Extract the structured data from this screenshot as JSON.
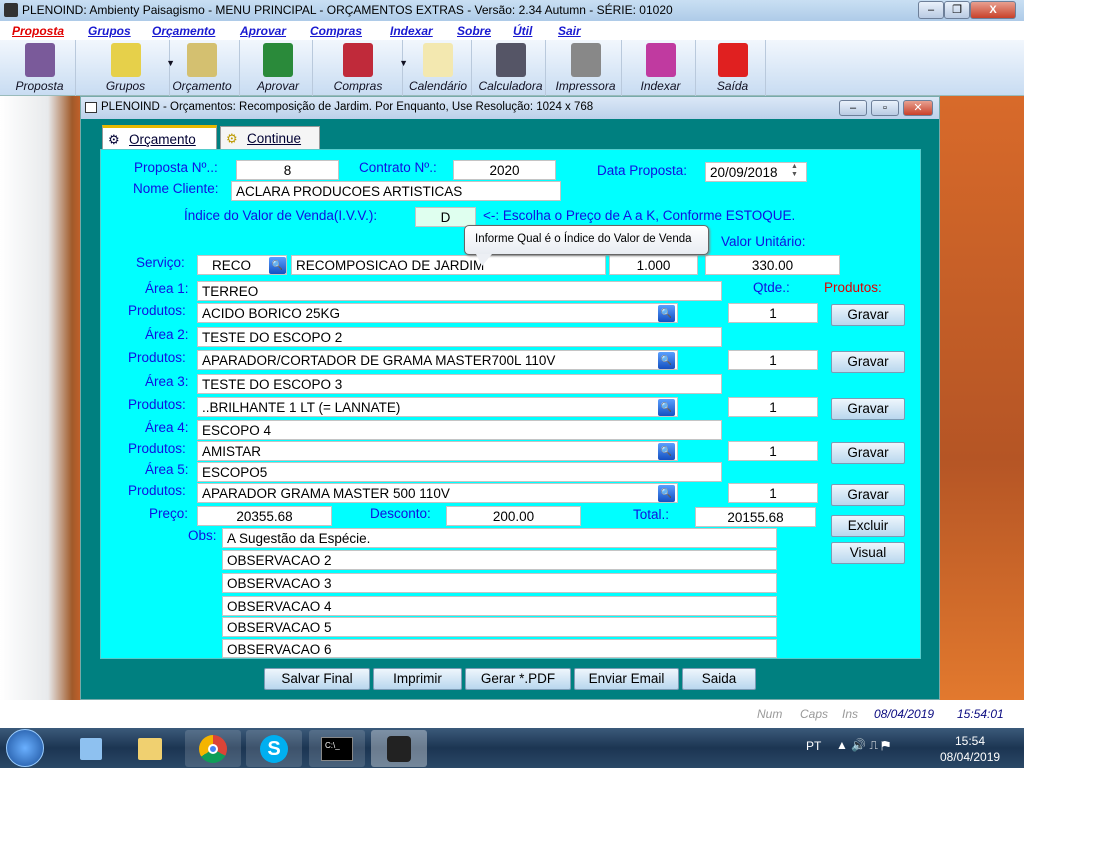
{
  "app": {
    "title": "PLENOIND: Ambienty Paisagismo - MENU PRINCIPAL - ORÇAMENTOS EXTRAS - Versão: 2.34 Autumn - SÉRIE: 01020"
  },
  "menu": [
    {
      "label": "Proposta",
      "color": "#e00000"
    },
    {
      "label": "Grupos"
    },
    {
      "label": "Orçamento"
    },
    {
      "label": "Aprovar"
    },
    {
      "label": "Compras"
    },
    {
      "label": "Indexar"
    },
    {
      "label": "Sobre"
    },
    {
      "label": "Útil"
    },
    {
      "label": "Sair"
    }
  ],
  "toolbar": [
    {
      "label": "Proposta",
      "icon": "proposal-icon"
    },
    {
      "label": "Grupos",
      "icon": "groups-icon"
    },
    {
      "label": "Orçamento",
      "icon": "budget-icon"
    },
    {
      "label": "Aprovar",
      "icon": "approve-icon"
    },
    {
      "label": "Compras",
      "icon": "purchases-icon"
    },
    {
      "label": "Calendário",
      "icon": "calendar-icon"
    },
    {
      "label": "Calculadora",
      "icon": "calculator-icon"
    },
    {
      "label": "Impressora",
      "icon": "printer-icon"
    },
    {
      "label": "Indexar",
      "icon": "index-icon"
    },
    {
      "label": "Saída",
      "icon": "exit-icon"
    }
  ],
  "window": {
    "title": "PLENOIND - Orçamentos: Recomposição de Jardim. Por Enquanto, Use Resolução: 1024 x 768"
  },
  "tabs": [
    {
      "label": "Orçamento",
      "active": true
    },
    {
      "label": "Continue"
    }
  ],
  "form": {
    "proposta_label": "Proposta Nº..:",
    "proposta": "8",
    "contrato_label": "Contrato Nº.:",
    "contrato": "2020",
    "data_label": "Data Proposta:",
    "data": "20/09/2018",
    "cliente_label": "Nome Cliente:",
    "cliente": "ACLARA PRODUCOES ARTISTICAS",
    "ivv_label": "Índice do Valor de Venda(I.V.V.):",
    "ivv": "D",
    "ivv_hint": "<-: Escolha o Preço de A a K, Conforme ESTOQUE.",
    "tooltip": "Informe Qual é o Índice do Valor de Venda",
    "qtde_header": "Qtde:",
    "valor_header": "Valor Unitário:",
    "servico_label": "Serviço:",
    "servico_code": "RECO",
    "servico_desc": "RECOMPOSICAO DE JARDIM",
    "servico_qtde": "1.000",
    "servico_valor": "330.00",
    "qtde2_header": "Qtde.:",
    "produtos_header": "Produtos:",
    "produtos_label": "Produtos:",
    "gravar_label": "Gravar",
    "areas": [
      {
        "label": "Área 1:",
        "value": "TERREO",
        "produto": "ACIDO BORICO 25KG",
        "qtde": "1"
      },
      {
        "label": "Área 2:",
        "value": "TESTE DO ESCOPO 2",
        "produto": "APARADOR/CORTADOR DE GRAMA MASTER700L 110V",
        "qtde": "1"
      },
      {
        "label": "Área 3:",
        "value": "TESTE DO ESCOPO 3",
        "produto": "..BRILHANTE 1 LT (= LANNATE)",
        "qtde": "1"
      },
      {
        "label": "Área 4:",
        "value": "ESCOPO 4",
        "produto": "AMISTAR",
        "qtde": "1"
      },
      {
        "label": "Área 5:",
        "value": "ESCOPO5",
        "produto": "APARADOR GRAMA MASTER 500 110V",
        "qtde": "1"
      }
    ],
    "preco_label": "Preço:",
    "preco": "20355.68",
    "desconto_label": "Desconto:",
    "desconto": "200.00",
    "total_label": "Total.:",
    "total": "20155.68",
    "excluir": "Excluir",
    "visual": "Visual",
    "obs_label": "Obs:",
    "obs": [
      "A Sugestão da Espécie.",
      "OBSERVACAO 2",
      "OBSERVACAO 3",
      "OBSERVACAO 4",
      "OBSERVACAO 5",
      "OBSERVACAO 6"
    ]
  },
  "actions": [
    "Salvar Final",
    "Imprimir",
    "Gerar *.PDF",
    "Enviar Email",
    "Saida"
  ],
  "status": {
    "num": "Num",
    "caps": "Caps",
    "ins": "Ins",
    "date": "08/04/2019",
    "time": "15:54:01"
  },
  "taskbar": {
    "lang": "PT",
    "clock_time": "15:54",
    "clock_date": "08/04/2019"
  },
  "colors": {
    "panel": "#00ffff",
    "frame": "#008080",
    "label": "#1010e0"
  }
}
